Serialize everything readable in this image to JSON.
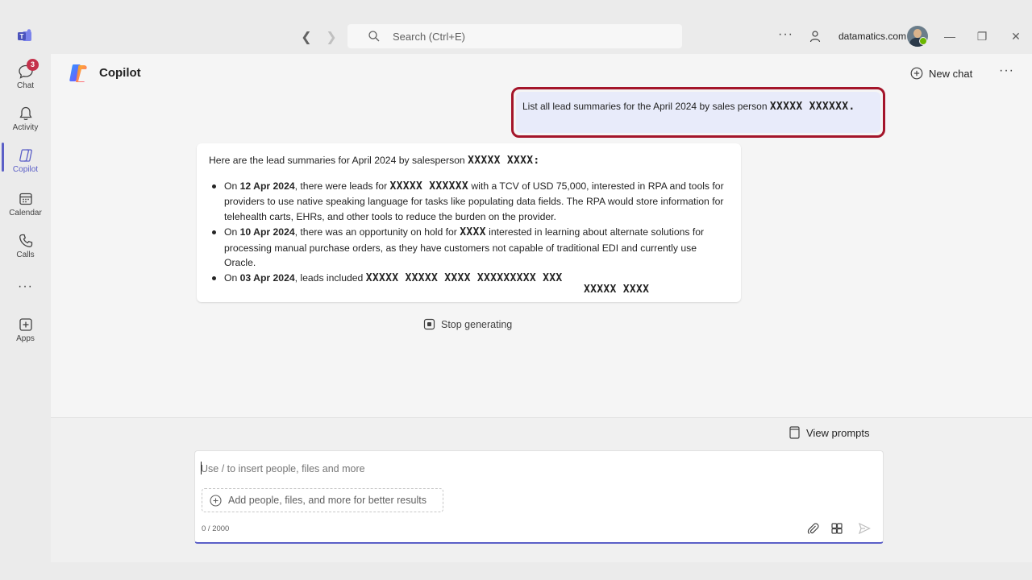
{
  "titlebar": {
    "search_placeholder": "Search (Ctrl+E)",
    "org_name": "datamatics.com",
    "more": "···"
  },
  "rail": {
    "items": [
      {
        "label": "Chat",
        "badge": "3"
      },
      {
        "label": "Activity"
      },
      {
        "label": "Copilot"
      },
      {
        "label": "Calendar"
      },
      {
        "label": "Calls"
      },
      {
        "label": "Apps"
      }
    ],
    "more": "···"
  },
  "header": {
    "title": "Copilot",
    "new_chat": "New chat",
    "more": "···"
  },
  "user_message": {
    "text": "List all lead summaries for the April 2024 by sales person ",
    "redacted": "XXXXX XXXXXX."
  },
  "bot_message": {
    "intro": "Here are the lead summaries for April 2024 by salesperson ",
    "intro_redacted": "XXXXX XXXX:",
    "items": [
      {
        "prefix": "On ",
        "date": "12 Apr 2024",
        "text_a": ", there were leads for ",
        "redacted": "XXXXX XXXXXX",
        "text_b": " with a TCV of USD 75,000, interested in RPA and tools for providers to use native speaking language for tasks like populating data fields. The RPA would store information for telehealth carts, EHRs, and other tools to reduce the burden on the provider."
      },
      {
        "prefix": "On ",
        "date": "10 Apr 2024",
        "text_a": ", there was an opportunity on hold for ",
        "redacted": "XXXX",
        "text_b": " interested in learning about alternate solutions for processing manual purchase orders, as they have customers not capable of traditional EDI and currently use Oracle."
      },
      {
        "prefix": "On ",
        "date": "03 Apr 2024",
        "text_a": ", leads included ",
        "redacted": "XXXXX XXXXX XXXX XXXXXXXXX XXX",
        "text_b": ""
      }
    ],
    "extra_redacted": "XXXXX XXXX"
  },
  "stop_generating": "Stop generating",
  "composer": {
    "view_prompts": "View prompts",
    "placeholder": "Use / to insert people, files and more",
    "add_people": "Add people, files, and more for better results",
    "char_count": "0 / 2000"
  },
  "colors": {
    "accent": "#5b5fc7",
    "highlight_border": "#a4152a",
    "user_bubble": "#e8ebfa",
    "badge": "#c4314b"
  }
}
